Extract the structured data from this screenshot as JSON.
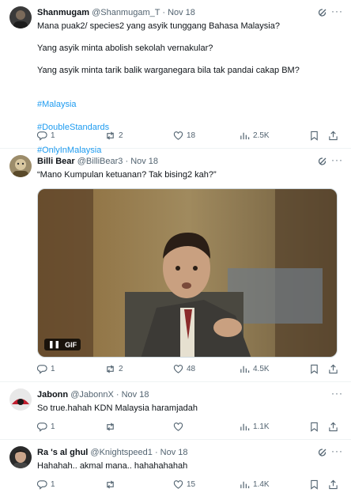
{
  "tweets": [
    {
      "name": "Shanmugam",
      "handle": "@Shanmugam_T",
      "date": "Nov 18",
      "text": "Mana puak2/ species2 yang asyik tunggang Bahasa Malaysia?\n\nYang asyik minta abolish sekolah vernakular?\n\nYang asyik minta tarik balik warganegara bila tak pandai cakap BM?",
      "hashtags": [
        "#Malaysia",
        "#DoubleStandards",
        "#OnlyInMalaysia"
      ],
      "replies": "1",
      "reposts": "2",
      "likes": "18",
      "views": "2.5K"
    },
    {
      "name": "Billi Bear",
      "handle": "@BilliBear3",
      "date": "Nov 18",
      "text": "“Mano Kumpulan ketuanan? Tak bising2 kah?”",
      "gif_label": "GIF",
      "replies": "1",
      "reposts": "2",
      "likes": "48",
      "views": "4.5K"
    },
    {
      "name": "Jabonn",
      "handle": "@JabonnX",
      "date": "Nov 18",
      "text": "So true.hahah KDN Malaysia haramjadah",
      "replies": "1",
      "reposts": "",
      "likes": "",
      "views": "1.1K"
    },
    {
      "name": "Ra 's al ghul",
      "handle": "@Knightspeed1",
      "date": "Nov 18",
      "text": "Hahahah.. akmal mana.. hahahahahah",
      "replies": "1",
      "reposts": "",
      "likes": "15",
      "views": "1.4K"
    }
  ],
  "separator": "·",
  "colors": {
    "link": "#1d9bf0",
    "muted": "#536471",
    "text": "#0f1419"
  }
}
